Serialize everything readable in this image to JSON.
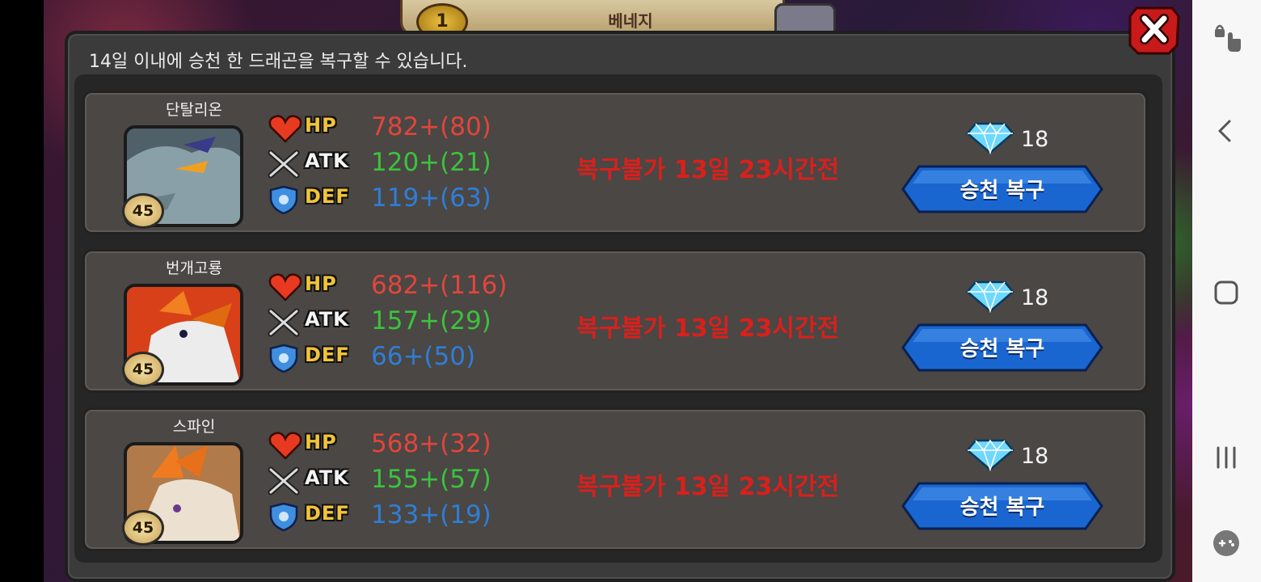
{
  "background": {
    "top_tab_title": "베네지",
    "top_tab_coin": "1"
  },
  "dialog": {
    "notice": "14일 이내에 승천 한 드래곤을 복구할 수 있습니다.",
    "close_icon": "close-x-icon"
  },
  "dragons": [
    {
      "name": "단탈리온",
      "level": "45",
      "hp_label": "HP",
      "hp": "782+(80)",
      "atk_label": "ATK",
      "atk": "120+(21)",
      "def_label": "DEF",
      "def": "119+(63)",
      "status": "복구불가 13일 23시간전",
      "gem_cost": "18",
      "button": "승천 복구",
      "portrait_color": "#4a5a62"
    },
    {
      "name": "번개고룡",
      "level": "45",
      "hp_label": "HP",
      "hp": "682+(116)",
      "atk_label": "ATK",
      "atk": "157+(29)",
      "def_label": "DEF",
      "def": "66+(50)",
      "status": "복구불가 13일 23시간전",
      "gem_cost": "18",
      "button": "승천 복구",
      "portrait_color": "#d8401a"
    },
    {
      "name": "스파인",
      "level": "45",
      "hp_label": "HP",
      "hp": "568+(32)",
      "atk_label": "ATK",
      "atk": "155+(57)",
      "def_label": "DEF",
      "def": "133+(19)",
      "status": "복구불가 13일 23시간전",
      "gem_cost": "18",
      "button": "승천 복구",
      "portrait_color": "#a0683a"
    }
  ],
  "icons": {
    "hp": "heart-icon",
    "atk": "crossed-swords-icon",
    "def": "shield-icon",
    "gem": "diamond-icon"
  },
  "colors": {
    "hp": "#e2453a",
    "atk": "#3cc23c",
    "def": "#2f7ed6",
    "status": "#d8201c",
    "button": "#1560c8"
  },
  "nav_bar": {
    "items": [
      "touch-lock-icon",
      "back-icon",
      "home-icon",
      "recent-apps-icon",
      "game-tools-icon"
    ]
  }
}
